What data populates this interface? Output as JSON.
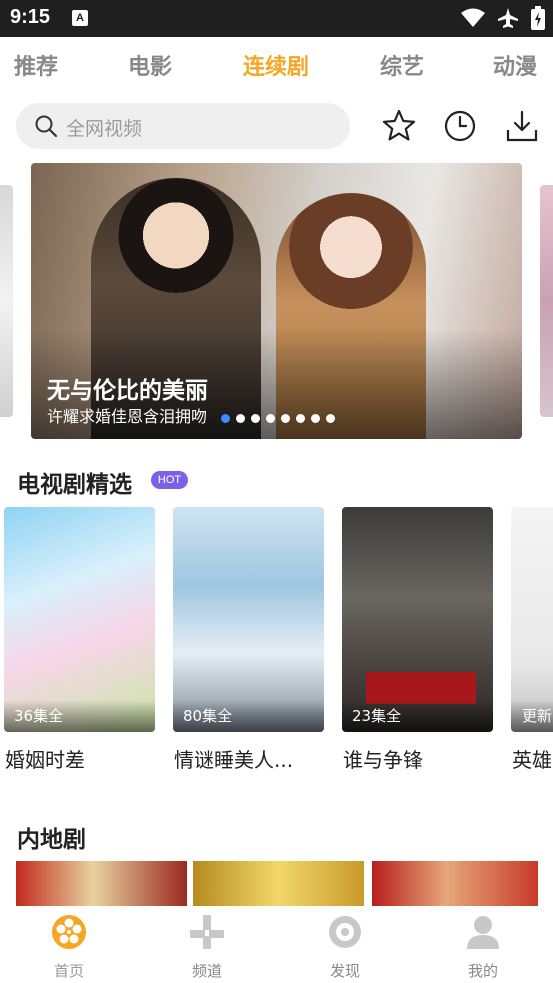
{
  "status_bar": {
    "time": "9:15",
    "sim_label": "A"
  },
  "top_tabs": [
    {
      "label": "推荐"
    },
    {
      "label": "电影"
    },
    {
      "label": "连续剧"
    },
    {
      "label": "综艺"
    },
    {
      "label": "动漫"
    }
  ],
  "active_tab": "连续剧",
  "search": {
    "placeholder": "全网视频"
  },
  "banner": {
    "title": "无与伦比的美丽",
    "subtitle": "许耀求婚佳恩含泪拥吻",
    "page_count": 8,
    "current_page": 1
  },
  "section_tv": {
    "title": "电视剧精选",
    "badge": "HOT",
    "items": [
      {
        "title": "婚姻时差",
        "episodes": "36集全"
      },
      {
        "title": "情谜睡美人...",
        "episodes": "80集全"
      },
      {
        "title": "谁与争锋",
        "episodes": "23集全"
      },
      {
        "title": "英雄",
        "episodes": "更新"
      }
    ]
  },
  "section_mainland": {
    "title": "内地剧"
  },
  "bottom_nav": [
    {
      "label": "首页"
    },
    {
      "label": "频道"
    },
    {
      "label": "发现"
    },
    {
      "label": "我的"
    }
  ],
  "colors": {
    "accent": "#f5a623",
    "hot_badge": "#7b61e8",
    "dot_active": "#3d8bff"
  }
}
